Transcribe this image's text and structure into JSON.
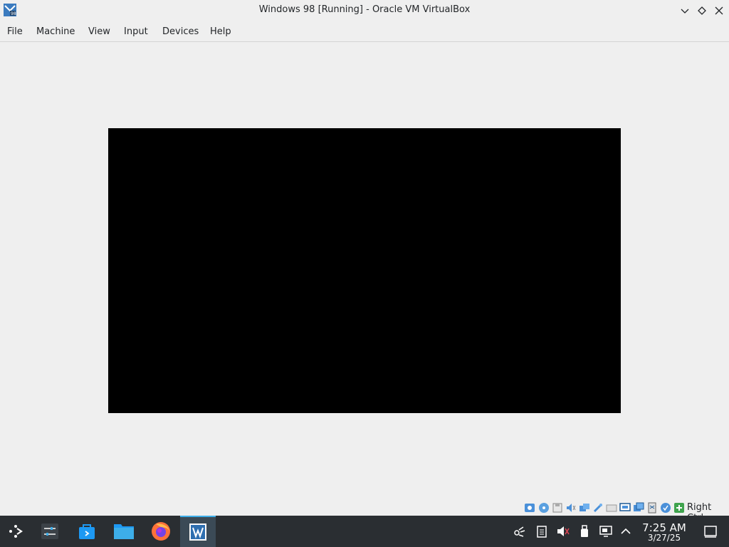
{
  "window": {
    "title": "Windows 98 [Running] - Oracle VM VirtualBox"
  },
  "menu": [
    "File",
    "Machine",
    "View",
    "Input",
    "Devices",
    "Help"
  ],
  "statusbar": {
    "icons": [
      "hard-disk-icon",
      "optical-drive-icon",
      "floppy-drive-icon",
      "audio-icon",
      "network-icon",
      "usb-icon",
      "shared-folders-icon",
      "display-icon",
      "recording-icon",
      "cpu-icon",
      "mouse-integration-icon",
      "keyboard-capture-icon"
    ],
    "host_key": "Right Ctrl"
  },
  "taskbar": {
    "clock_time": "7:25 AM",
    "clock_date": "3/27/25",
    "apps": [
      "application-launcher-icon",
      "system-settings-icon",
      "discover-store-icon",
      "file-manager-icon",
      "firefox-icon",
      "virtualbox-icon"
    ],
    "tray": [
      "network-manager-icon",
      "clipboard-icon",
      "volume-muted-icon",
      "removable-devices-icon",
      "display-configuration-icon",
      "tray-expand-icon"
    ]
  }
}
